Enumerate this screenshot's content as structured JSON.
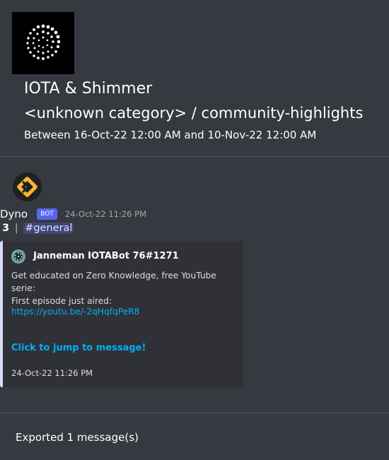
{
  "guild": {
    "name": "IOTA & Shimmer",
    "channel_path": "<unknown category> / community-highlights",
    "date_range": "Between 16-Oct-22 12:00 AM and 10-Nov-22 12:00 AM",
    "icon": "iota-logo"
  },
  "message": {
    "avatar_icon": "dyno-logo",
    "author": "Dyno",
    "bot_tag": "BOT",
    "timestamp": "24-Oct-22 11:26 PM",
    "reaction_count": "3",
    "separator": "|",
    "channel_mention": "#general",
    "embed": {
      "accent_color": "#d8dbf4",
      "author_icon": "iota-bot-avatar",
      "author_name": "Janneman IOTABot 76#1271",
      "description_line1": "Get educated on Zero Knowledge, free YouTube serie:",
      "description_line2": "First episode just aired:",
      "link": "https://youtu.be/-2qHqfqPeR8",
      "jump_label": "Click to jump to message!",
      "footer": "24-Oct-22 11:26 PM"
    }
  },
  "footer": {
    "text": "Exported 1 message(s)"
  },
  "colors": {
    "background": "#36393f",
    "embed_background": "#2f3136",
    "link": "#00aff4",
    "bot_tag": "#5865f2",
    "dyno_accent": "#f7b731"
  }
}
